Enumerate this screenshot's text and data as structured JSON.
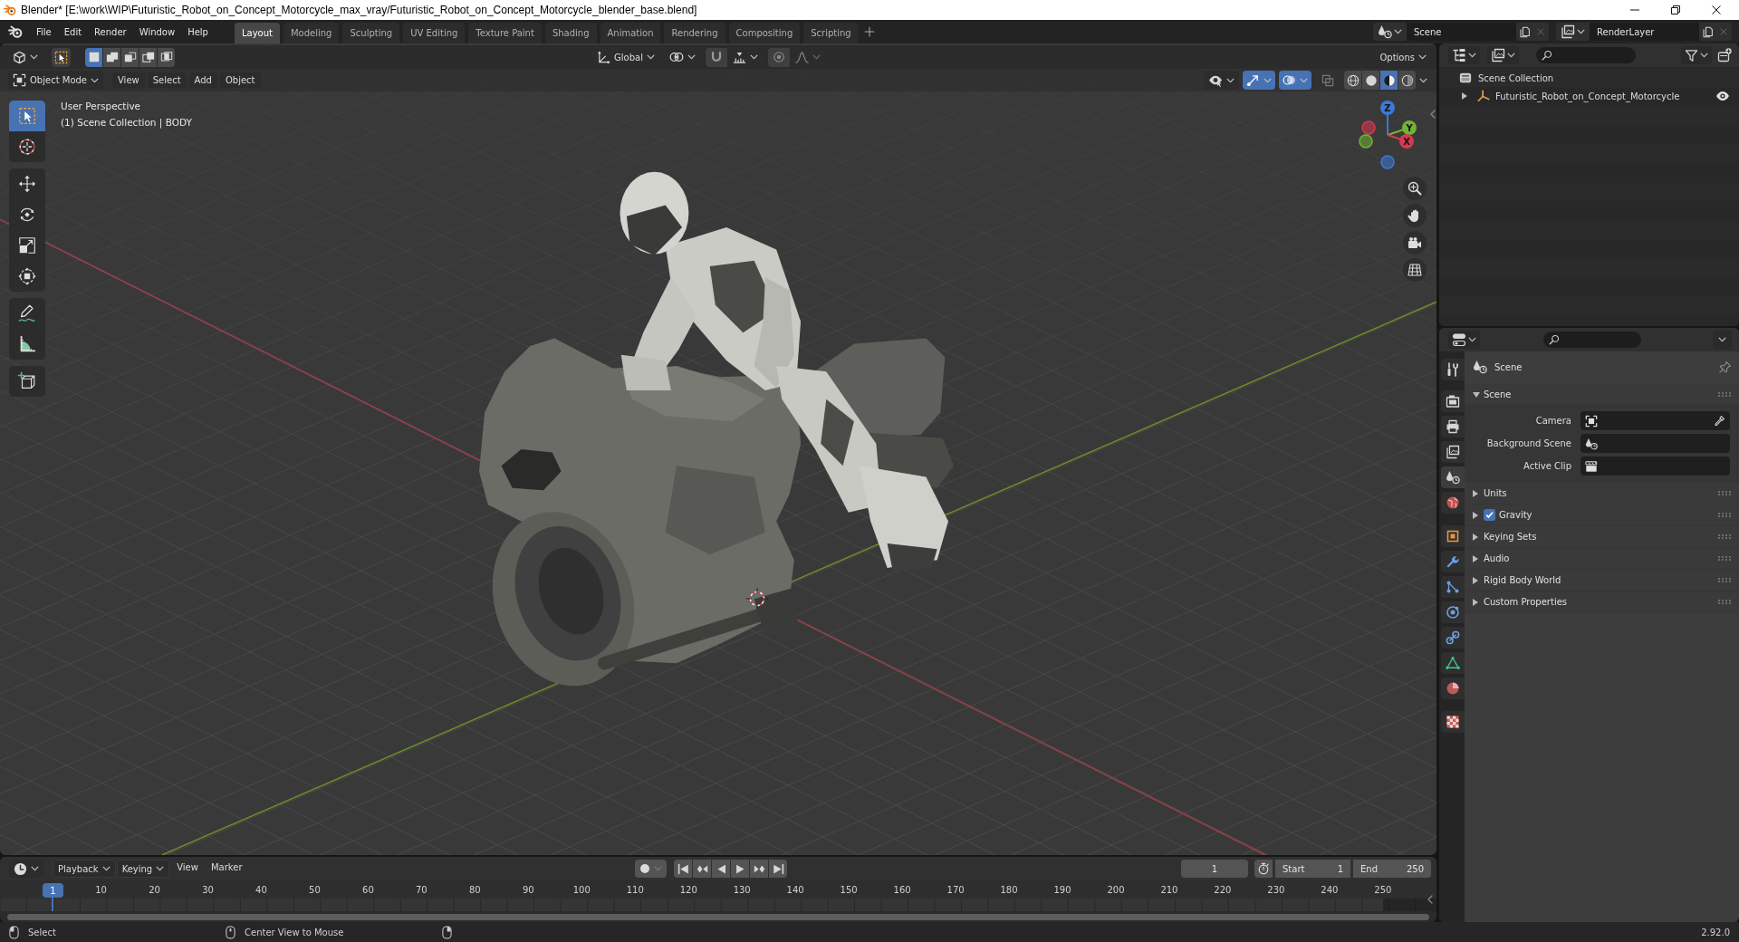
{
  "window": {
    "title": "Blender* [E:\\work\\WIP\\Futuristic_Robot_on_Concept_Motorcycle_max_vray/Futuristic_Robot_on_Concept_Motorcycle_blender_base.blend]"
  },
  "menu": [
    "File",
    "Edit",
    "Render",
    "Window",
    "Help"
  ],
  "workspaces": [
    {
      "label": "Layout",
      "selected": true
    },
    {
      "label": "Modeling",
      "selected": false
    },
    {
      "label": "Sculpting",
      "selected": false
    },
    {
      "label": "UV Editing",
      "selected": false
    },
    {
      "label": "Texture Paint",
      "selected": false
    },
    {
      "label": "Shading",
      "selected": false
    },
    {
      "label": "Animation",
      "selected": false
    },
    {
      "label": "Rendering",
      "selected": false
    },
    {
      "label": "Compositing",
      "selected": false
    },
    {
      "label": "Scripting",
      "selected": false
    }
  ],
  "scene": "Scene",
  "view_layer": "RenderLayer",
  "viewport": {
    "tool_header": {
      "select_modes": [
        {
          "kind": "set",
          "selected": true
        },
        {
          "kind": "extend",
          "selected": false
        },
        {
          "kind": "subtract",
          "selected": false
        },
        {
          "kind": "difference",
          "selected": false
        },
        {
          "kind": "intersect",
          "selected": false
        }
      ],
      "orientation": "Global",
      "snap": {
        "on": false
      },
      "proportional": {
        "on": false
      },
      "options": "Options"
    },
    "header": {
      "mode": "Object Mode",
      "menus": [
        "View",
        "Select",
        "Add",
        "Object"
      ],
      "gizmos": {
        "on": true
      },
      "overlays": {
        "on": true
      },
      "xray": {
        "on": false
      },
      "shading": [
        {
          "kind": "wireframe",
          "selected": false
        },
        {
          "kind": "solid",
          "selected": false
        },
        {
          "kind": "material",
          "selected": true
        },
        {
          "kind": "rendered",
          "selected": false
        }
      ]
    },
    "info": [
      "User Perspective",
      "(1) Scene Collection | BODY"
    ],
    "toolbar": [
      {
        "tools": [
          {
            "kind": "select",
            "selected": true
          },
          {
            "kind": "cursor",
            "selected": false
          }
        ]
      },
      {
        "tools": [
          {
            "kind": "move",
            "selected": false
          },
          {
            "kind": "rotate",
            "selected": false
          },
          {
            "kind": "scale",
            "selected": false
          },
          {
            "kind": "transform",
            "selected": false
          }
        ]
      },
      {
        "tools": [
          {
            "kind": "annotate",
            "selected": false
          },
          {
            "kind": "measure",
            "selected": false
          }
        ]
      },
      {
        "tools": [
          {
            "kind": "cube",
            "selected": false
          }
        ]
      }
    ],
    "gizmo_axes": [
      {
        "label": "X",
        "color": "#d8394c"
      },
      {
        "label": "Y",
        "color": "#73b436"
      },
      {
        "label": "Z",
        "color": "#3c79d4"
      }
    ]
  },
  "outliner": {
    "items": [
      {
        "label": "Scene Collection",
        "children": [
          {
            "label": "Futuristic_Robot_on_Concept_Motorcycle",
            "expanded": false,
            "visible": true
          }
        ]
      }
    ]
  },
  "properties": {
    "tab_groups": [
      {
        "tabs": [
          {
            "kind": "tool",
            "selected": false
          }
        ]
      },
      {
        "tabs": [
          {
            "kind": "render",
            "selected": false
          },
          {
            "kind": "output",
            "selected": false
          },
          {
            "kind": "viewlayer",
            "selected": false
          },
          {
            "kind": "scene",
            "selected": true
          },
          {
            "kind": "world",
            "selected": false
          }
        ]
      },
      {
        "tabs": [
          {
            "kind": "object",
            "selected": false
          },
          {
            "kind": "modifiers",
            "selected": false
          },
          {
            "kind": "particles",
            "selected": false
          },
          {
            "kind": "physics",
            "selected": false
          },
          {
            "kind": "constraints",
            "selected": false
          },
          {
            "kind": "data",
            "selected": false
          },
          {
            "kind": "material",
            "selected": false
          }
        ]
      },
      {
        "tabs": [
          {
            "kind": "texture",
            "selected": false
          }
        ]
      }
    ],
    "context": "Scene",
    "panels": [
      {
        "label": "Scene",
        "expanded": true,
        "fields": [
          {
            "label": "Camera",
            "kind": "camera"
          },
          {
            "label": "Background Scene",
            "kind": "scene"
          },
          {
            "label": "Active Clip",
            "kind": "clip"
          }
        ]
      },
      {
        "label": "Units",
        "expanded": false
      },
      {
        "label": "Gravity",
        "expanded": false,
        "checked": true
      },
      {
        "label": "Keying Sets",
        "expanded": false
      },
      {
        "label": "Audio",
        "expanded": false
      },
      {
        "label": "Rigid Body World",
        "expanded": false
      },
      {
        "label": "Custom Properties",
        "expanded": false
      }
    ]
  },
  "timeline": {
    "menus": [
      {
        "label": "Playback",
        "kind": "dropdown"
      },
      {
        "label": "Keying",
        "kind": "dropdown"
      },
      {
        "label": "View",
        "kind": "menu"
      },
      {
        "label": "Marker",
        "kind": "menu"
      }
    ],
    "auto_keying": {
      "on": false
    },
    "current_frame": "1",
    "start": {
      "label": "Start",
      "value": "1"
    },
    "end": {
      "label": "End",
      "value": "250"
    },
    "playhead": "1",
    "ruler": [
      "10",
      "20",
      "30",
      "40",
      "50",
      "60",
      "70",
      "80",
      "90",
      "100",
      "110",
      "120",
      "130",
      "140",
      "150",
      "160",
      "170",
      "180",
      "190",
      "200",
      "210",
      "220",
      "230",
      "240",
      "250"
    ]
  },
  "status_bar": {
    "hints": [
      {
        "kind": "left",
        "label": "Select"
      },
      {
        "kind": "middle",
        "label": "Center View to Mouse"
      },
      {
        "kind": "right"
      }
    ],
    "version": "2.92.0"
  }
}
